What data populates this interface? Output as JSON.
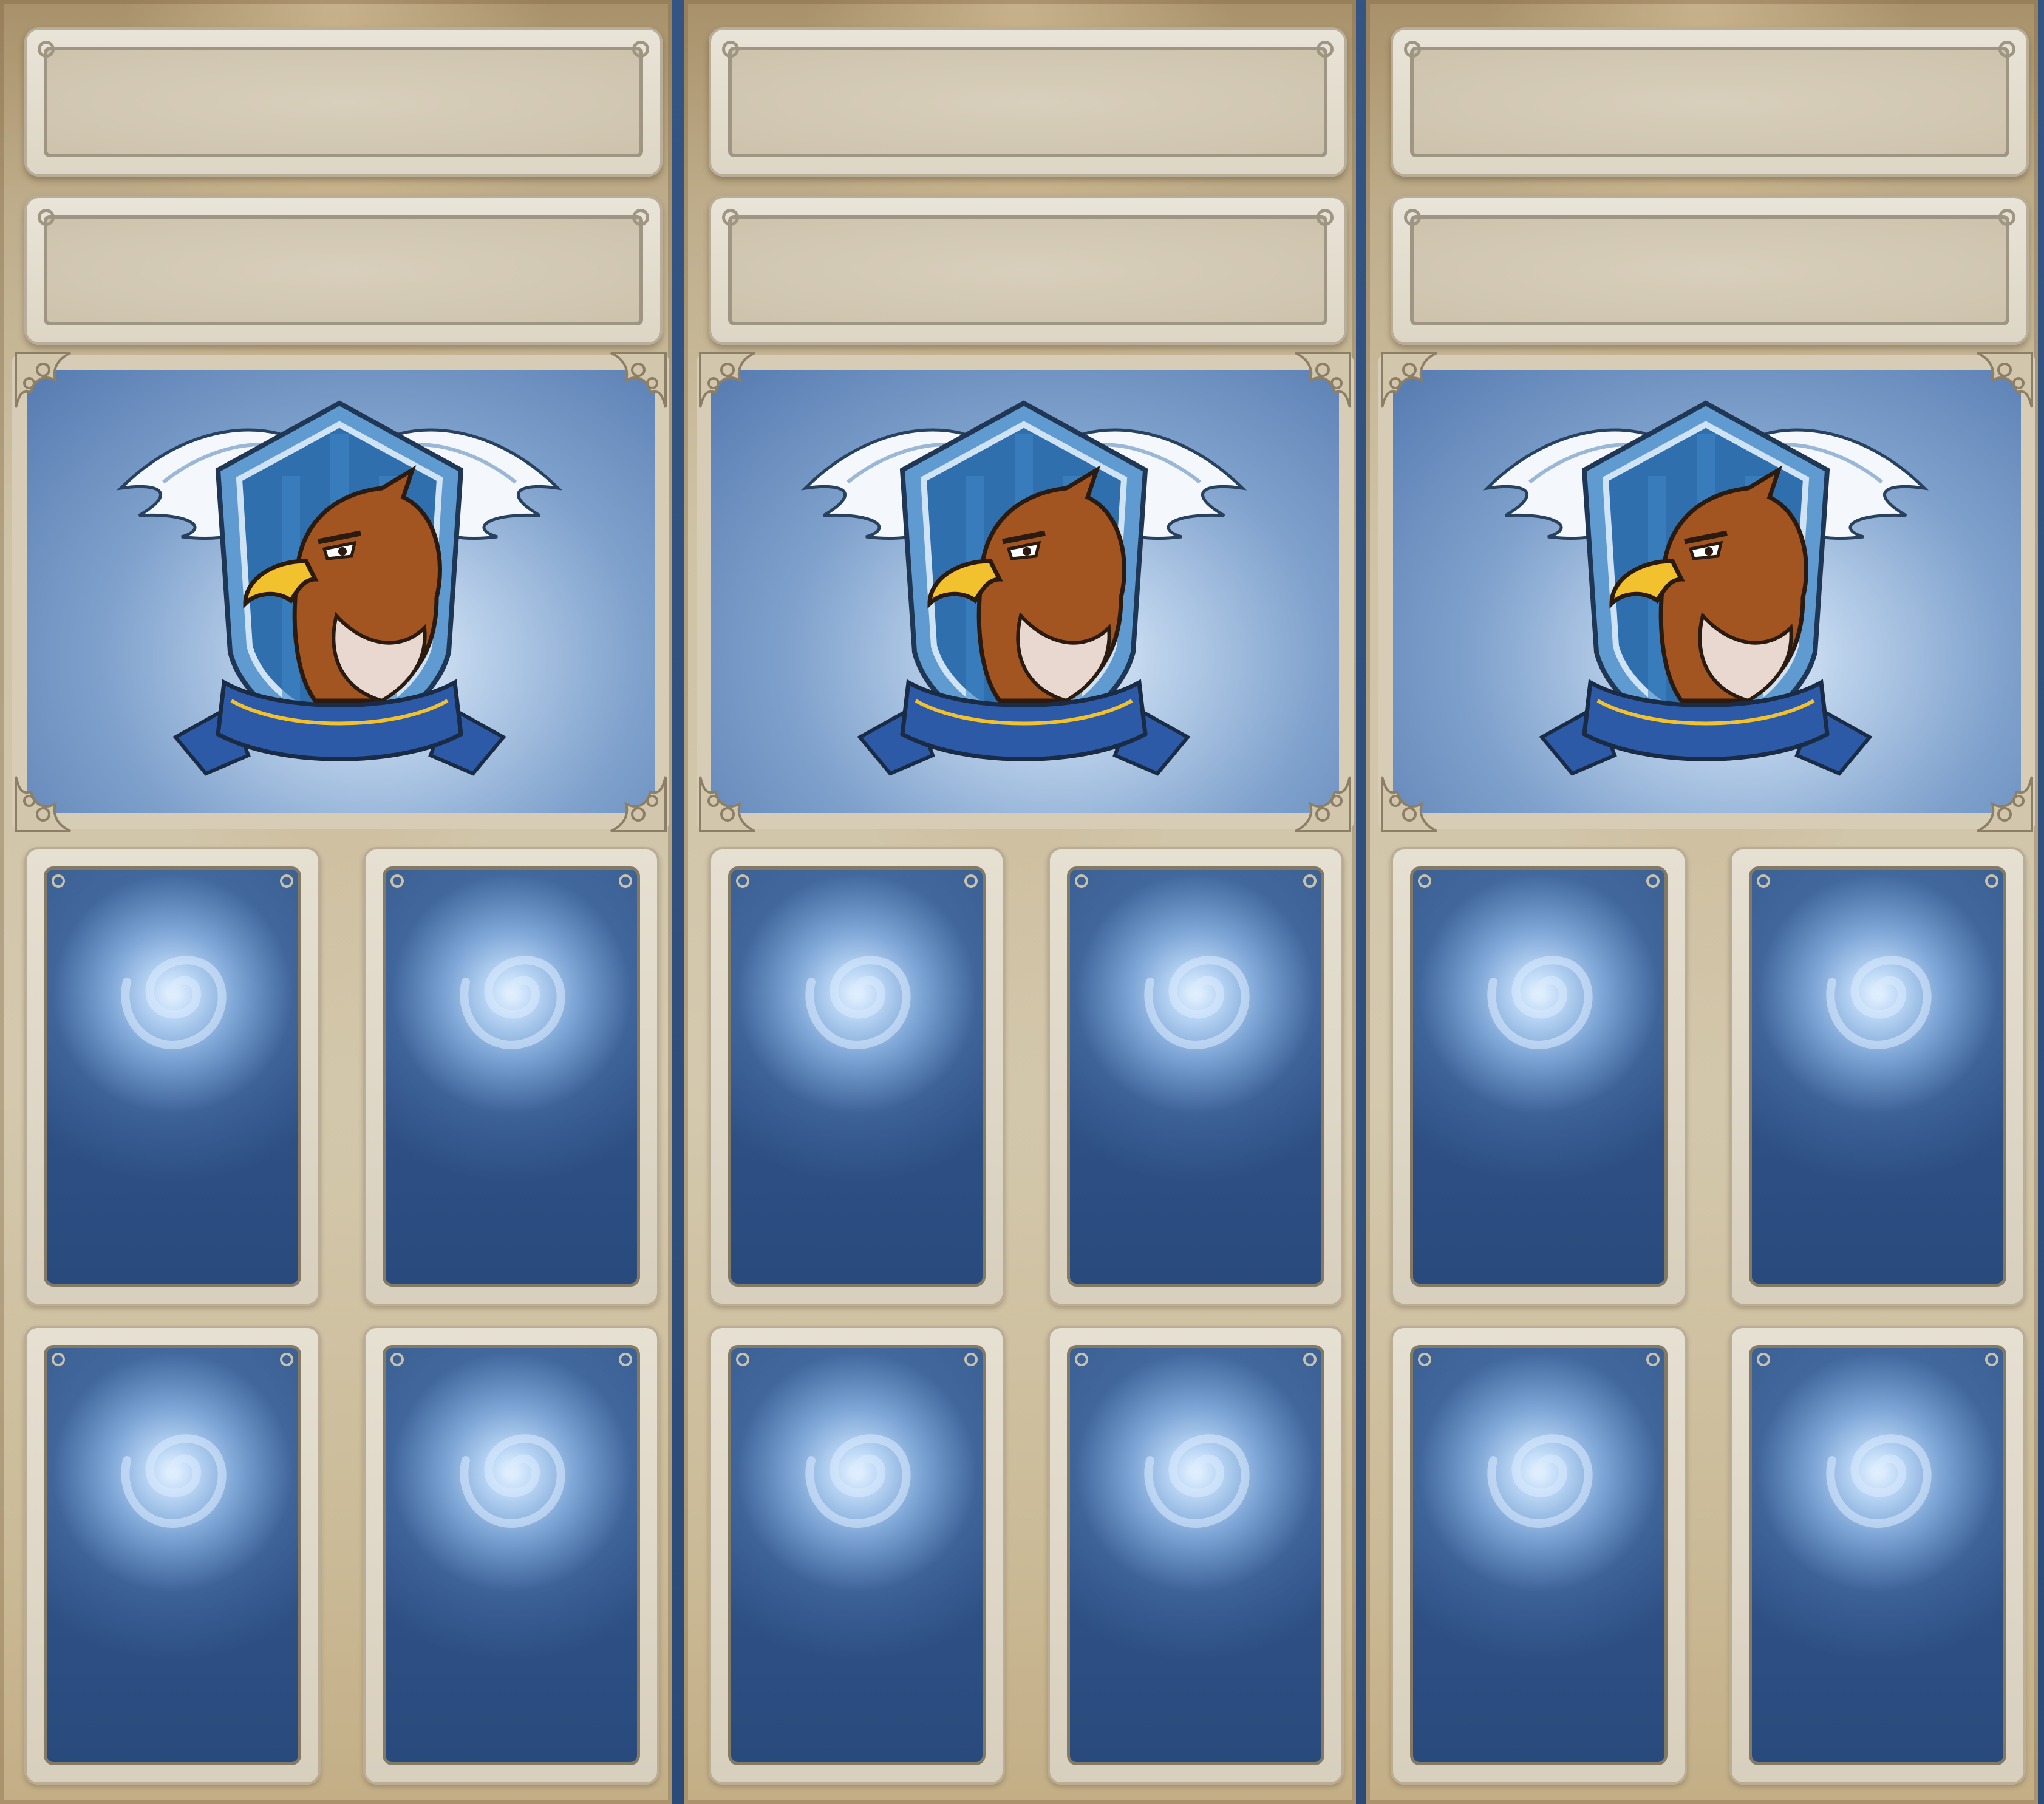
{
  "board": {
    "theme_colors": {
      "parchment": "#d4c9ae",
      "frame": "#b9ad96",
      "card_blue": "#2f5186",
      "crest_sky": "#7fa1cc",
      "eagle_brown": "#9a4f24",
      "beak_yellow": "#f2c12e",
      "banner_blue": "#2d5aa6"
    },
    "panels": [
      {
        "name_plate": "",
        "subtitle_plate": "",
        "crest": {
          "icon": "eagle-crest-icon"
        },
        "card_slots": [
          {
            "icon": "swirl-card-back-icon"
          },
          {
            "icon": "swirl-card-back-icon"
          },
          {
            "icon": "swirl-card-back-icon"
          },
          {
            "icon": "swirl-card-back-icon"
          }
        ]
      },
      {
        "name_plate": "",
        "subtitle_plate": "",
        "crest": {
          "icon": "eagle-crest-icon"
        },
        "card_slots": [
          {
            "icon": "swirl-card-back-icon"
          },
          {
            "icon": "swirl-card-back-icon"
          },
          {
            "icon": "swirl-card-back-icon"
          },
          {
            "icon": "swirl-card-back-icon"
          }
        ]
      },
      {
        "name_plate": "",
        "subtitle_plate": "",
        "crest": {
          "icon": "eagle-crest-icon"
        },
        "card_slots": [
          {
            "icon": "swirl-card-back-icon"
          },
          {
            "icon": "swirl-card-back-icon"
          },
          {
            "icon": "swirl-card-back-icon"
          },
          {
            "icon": "swirl-card-back-icon"
          }
        ]
      }
    ]
  }
}
